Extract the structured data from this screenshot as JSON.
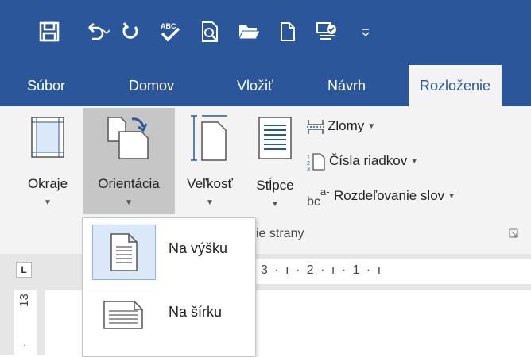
{
  "quick_access_toolbar": {
    "icons": [
      "save-icon",
      "undo-icon",
      "undo-dropdown-icon",
      "redo-icon",
      "spelling-icon",
      "print-preview-icon",
      "open-icon",
      "new-document-icon",
      "touch-mode-icon",
      "customize-dropdown-icon"
    ]
  },
  "ribbon_tabs": [
    {
      "label": "Súbor",
      "active": false
    },
    {
      "label": "Domov",
      "active": false
    },
    {
      "label": "Vložiť",
      "active": false
    },
    {
      "label": "Návrh",
      "active": false
    },
    {
      "label": "Rozloženie",
      "active": true
    }
  ],
  "page_setup_group": {
    "label": "Nastavenie strany",
    "visible_label": "ie strany",
    "buttons": [
      {
        "label": "Okraje",
        "icon": "margins-icon"
      },
      {
        "label": "Orientácia",
        "icon": "orientation-icon",
        "pressed": true
      },
      {
        "label": "Veľkosť",
        "icon": "size-icon"
      },
      {
        "label": "Stĺpce",
        "icon": "columns-icon"
      }
    ],
    "small_items": [
      {
        "label": "Zlomy",
        "icon": "breaks-icon"
      },
      {
        "label": "Čísla riadkov",
        "icon": "line-numbers-icon"
      },
      {
        "label": "Rozdeľovanie slov",
        "icon": "hyphenation-icon"
      }
    ]
  },
  "orientation_dropdown": {
    "items": [
      {
        "label": "Na výšku",
        "icon": "portrait-page-icon",
        "selected": true
      },
      {
        "label": "Na šírku",
        "icon": "landscape-page-icon",
        "selected": false
      }
    ]
  },
  "ruler": {
    "tab_selector": "L",
    "horizontal_text": "3 · ı · 2 · ı · 1 · ı",
    "vertical_number": "13",
    "vertical_mark": "·"
  },
  "colors": {
    "title_bar": "#2b579a",
    "ribbon_bg": "#f3f3f3",
    "pressed_button": "#c6c6c6",
    "selected_item_bg": "#dbe8f7",
    "selected_item_border": "#8fb3e2"
  }
}
